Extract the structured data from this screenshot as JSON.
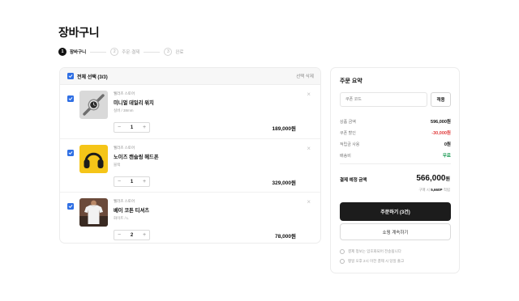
{
  "page": {
    "title": "장바구니"
  },
  "steps": [
    {
      "num": "1",
      "label": "장바구니"
    },
    {
      "num": "2",
      "label": "주문·결제"
    },
    {
      "num": "3",
      "label": "완료"
    }
  ],
  "cart": {
    "select_all_label": "전체 선택 (3/3)",
    "delete_selected_label": "선택 삭제",
    "items": [
      {
        "brand": "웰라츠 스토어",
        "name": "미니멀 데일리 워치",
        "option": "실버 / 38mm",
        "qty": "1",
        "price": "189,000원",
        "thumb_icon": "watch-icon",
        "checked": true
      },
      {
        "brand": "웰라츠 스토어",
        "name": "노이즈 캔슬링 헤드폰",
        "option": "블랙",
        "qty": "1",
        "price": "329,000원",
        "thumb_icon": "headphones-icon",
        "checked": true
      },
      {
        "brand": "웰라츠 스토어",
        "name": "베이 코튼 티셔츠",
        "option": "화이트 / L",
        "qty": "2",
        "price": "78,000원",
        "thumb_icon": "tshirt-icon",
        "checked": true
      }
    ],
    "minus": "−",
    "plus": "+",
    "remove": "×"
  },
  "summary": {
    "title": "주문 요약",
    "coupon_placeholder": "쿠폰 코드",
    "apply_label": "적용",
    "rows": [
      {
        "label": "상품 금액",
        "value": "596,000원"
      },
      {
        "label": "쿠폰 할인",
        "value": "-30,000원"
      },
      {
        "label": "적립금 사용",
        "value": "0원"
      },
      {
        "label": "배송비",
        "value": "무료"
      }
    ],
    "total_label": "결제 예정 금액",
    "total_value": "566,000",
    "total_unit": "원",
    "points_prefix": "구매 시",
    "points_value": "5,660P",
    "points_suffix": "적립",
    "order_button": "주문하기 (3건)",
    "continue_button": "쇼핑 계속하기",
    "notes": [
      "결제 정보는 암호화되어 전송됩니다",
      "평일 오후 2시 이전 결제 시 당일 출고"
    ]
  },
  "colors": {
    "accent": "#2f6fe4",
    "discount": "#e03a3a",
    "free": "#1c9b55",
    "primary_button": "#1c1c1c"
  }
}
